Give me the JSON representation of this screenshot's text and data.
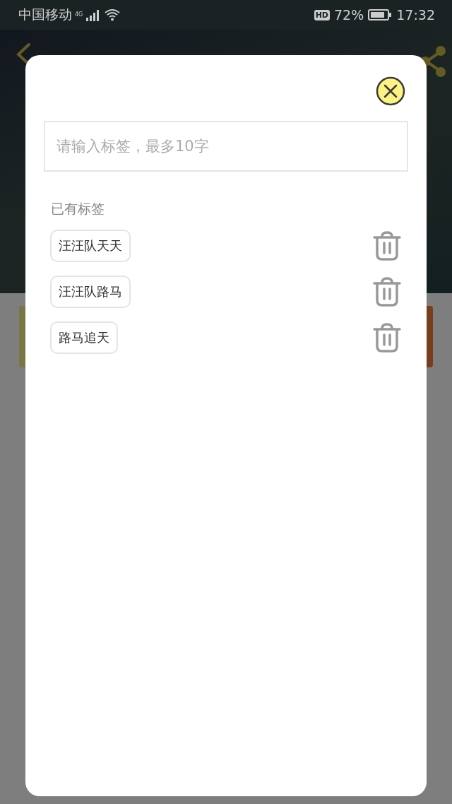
{
  "status_bar": {
    "carrier": "中国移动",
    "network": "4G",
    "hd": "HD",
    "battery": "72%",
    "time": "17:32"
  },
  "dialog": {
    "placeholder": "请输入标签，最多10字",
    "section_title": "已有标签",
    "tags": [
      {
        "label": "汪汪队天天"
      },
      {
        "label": "汪汪队路马"
      },
      {
        "label": "路马追天"
      }
    ]
  }
}
